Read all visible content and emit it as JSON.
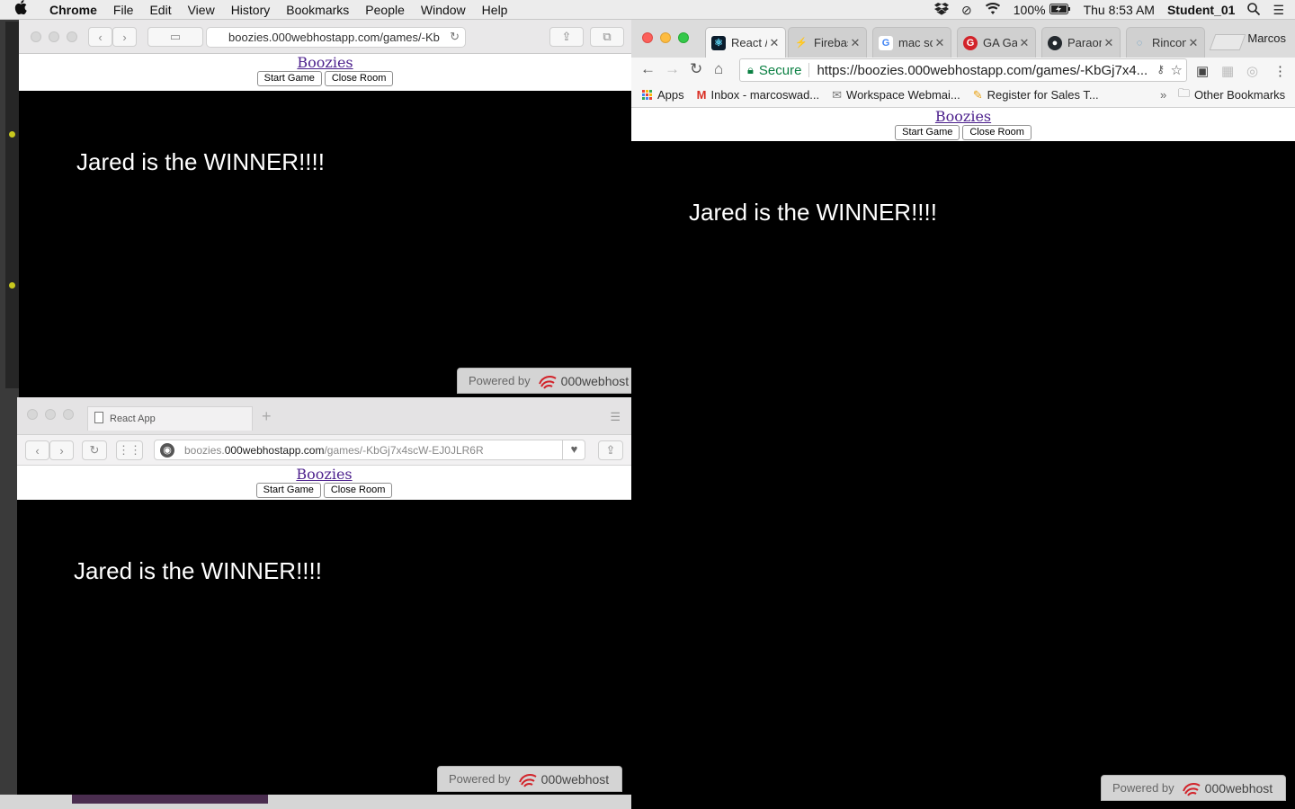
{
  "menubar": {
    "apple": "",
    "app_name": "Chrome",
    "menus": [
      "File",
      "Edit",
      "View",
      "History",
      "Bookmarks",
      "People",
      "Window",
      "Help"
    ],
    "battery": "100%",
    "clock": "Thu 8:53 AM",
    "user": "Student_01"
  },
  "safari_top": {
    "url": "boozies.000webhostapp.com/games/-Kb",
    "page": {
      "title": "Boozies",
      "start_button": "Start Game",
      "close_button": "Close Room",
      "winner_text": "Jared is the WINNER!!!!",
      "powered_label": "Powered by",
      "powered_brand": "000webhost"
    }
  },
  "safari_bottom": {
    "tab_title": "React App",
    "url_domain_prefix": "boozies.",
    "url_domain": "000webhostapp.com",
    "url_path": "/games/-KbGj7x4scW-EJ0JLR6R",
    "page": {
      "title": "Boozies",
      "start_button": "Start Game",
      "close_button": "Close Room",
      "winner_text": "Jared is the WINNER!!!!",
      "powered_label": "Powered by",
      "powered_brand": "000webhost"
    }
  },
  "chrome": {
    "profile_name": "Marcos",
    "tabs": [
      {
        "label": "React /",
        "favicon": "react-icon",
        "color": "#0b1c2c"
      },
      {
        "label": "Firebas",
        "favicon": "firebase-icon",
        "color": "#f6a623"
      },
      {
        "label": "mac sc",
        "favicon": "google-icon",
        "color": "#ffffff"
      },
      {
        "label": "GA Gal",
        "favicon": "ga-icon",
        "color": "#d2232a"
      },
      {
        "label": "Paraon",
        "favicon": "github-icon",
        "color": "#24292e"
      },
      {
        "label": "Rincon",
        "favicon": "rincon-icon",
        "color": "#4a90c2"
      }
    ],
    "secure_label": "Secure",
    "url": "https://boozies.000webhostapp.com/games/-KbGj7x4...",
    "bookmarks": [
      "Apps",
      "Inbox - marcoswad...",
      "Workspace Webmai...",
      "Register for Sales T..."
    ],
    "bookmarks_more": "»",
    "other_bookmarks": "Other Bookmarks",
    "page": {
      "title": "Boozies",
      "start_button": "Start Game",
      "close_button": "Close Room",
      "winner_text": "Jared is the WINNER!!!!",
      "powered_label": "Powered by",
      "powered_brand": "000webhost"
    }
  },
  "colors": {
    "link": "#4b1f8c",
    "secure_green": "#0b8043",
    "brand_red": "#d2232a"
  }
}
